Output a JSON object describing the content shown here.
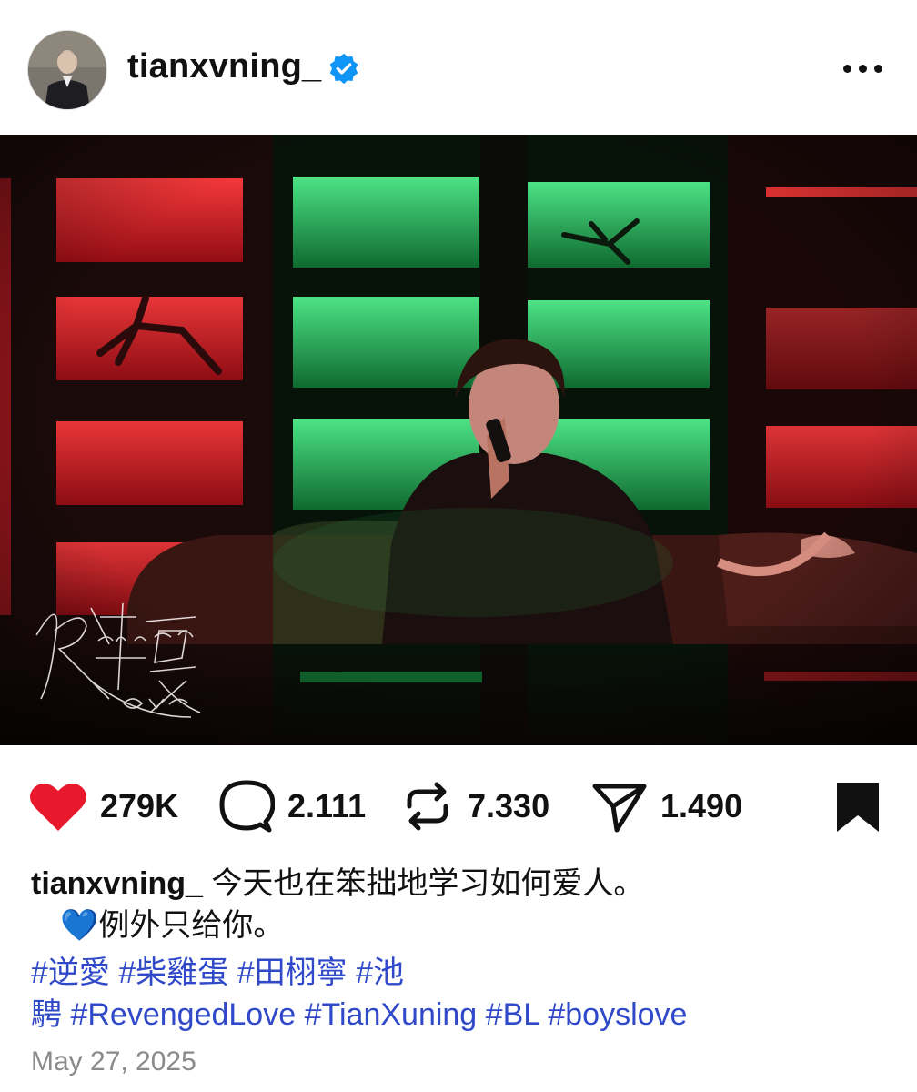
{
  "header": {
    "username": "tianxvning_",
    "verified_icon": "verified-badge-icon",
    "more_icon": "more-options-icon"
  },
  "photo": {
    "watermark_chinese": "逆愛",
    "watermark_english_top": "venged",
    "watermark_english_bottom": "ove",
    "colors": {
      "red": "#d8232a",
      "green": "#19a24b"
    }
  },
  "actions": {
    "likes": "279K",
    "comments": "2.111",
    "reposts": "7.330",
    "shares": "1.490",
    "like_color": "#e8192c"
  },
  "caption": {
    "username": "tianxvning_",
    "line1": "今天也在笨拙地学习如何爱人。",
    "line2_emoji": "💙",
    "line2": "例外只给你。"
  },
  "hashtags": {
    "line1": [
      "#逆愛",
      "#柴雞蛋",
      "#田栩寧",
      "#池"
    ],
    "line2": [
      "騁",
      "#RevengedLove",
      "#TianXuning",
      "#BL",
      "#boyslove"
    ]
  },
  "date": "May 27, 2025"
}
